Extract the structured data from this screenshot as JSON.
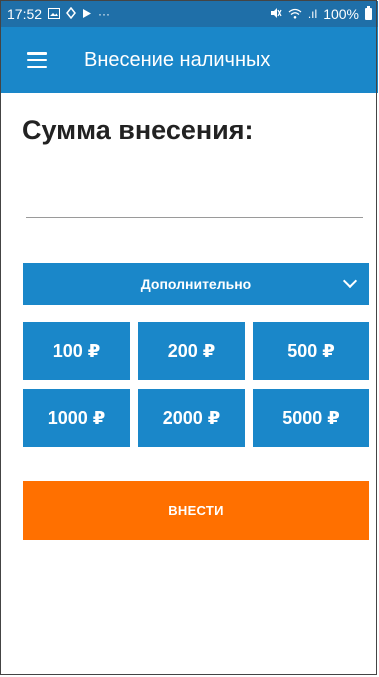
{
  "status_bar": {
    "time": "17:52",
    "notification_icons": [
      "image-icon",
      "sync-icon",
      "play-icon",
      "more-dots-icon"
    ],
    "more": "···",
    "signal_text": ".ıl",
    "battery_percent": "100%"
  },
  "app_bar": {
    "title": "Внесение наличных"
  },
  "form": {
    "label": "Сумма внесения:",
    "amount_value": "",
    "dropdown_label": "Дополнительно",
    "amounts": [
      "100 ₽",
      "200 ₽",
      "500 ₽",
      "1000 ₽",
      "2000 ₽",
      "5000 ₽"
    ],
    "submit_label": "ВНЕСТИ"
  },
  "colors": {
    "status_bar": "#1f6fa8",
    "primary": "#1a87c9",
    "accent": "#ff7000"
  }
}
